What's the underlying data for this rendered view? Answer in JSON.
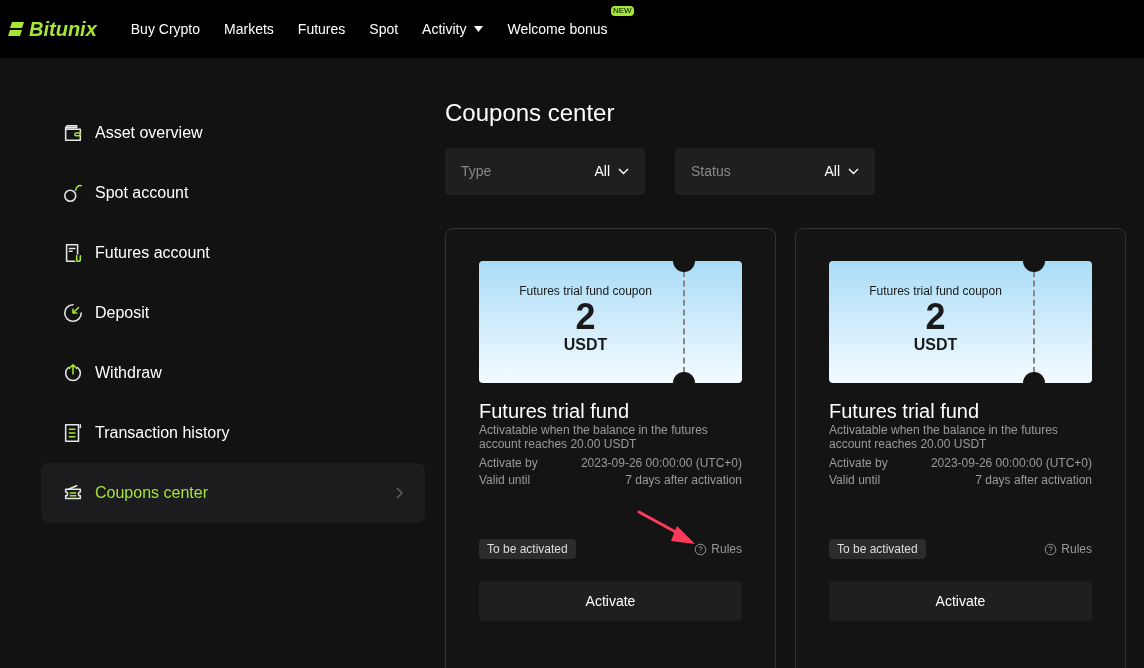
{
  "header": {
    "logo": "Bitunix",
    "nav": [
      {
        "label": "Buy Crypto",
        "dropdown": false
      },
      {
        "label": "Markets",
        "dropdown": false
      },
      {
        "label": "Futures",
        "dropdown": false
      },
      {
        "label": "Spot",
        "dropdown": false
      },
      {
        "label": "Activity",
        "dropdown": true
      },
      {
        "label": "Welcome bonus",
        "dropdown": false,
        "badge": "NEW"
      }
    ]
  },
  "sidebar": {
    "items": [
      {
        "kind": "wallet",
        "label": "Asset overview",
        "selected": false
      },
      {
        "kind": "spot",
        "label": "Spot account",
        "selected": false
      },
      {
        "kind": "futures",
        "label": "Futures account",
        "selected": false
      },
      {
        "kind": "deposit",
        "label": "Deposit",
        "selected": false
      },
      {
        "kind": "withdraw",
        "label": "Withdraw",
        "selected": false
      },
      {
        "kind": "history",
        "label": "Transaction history",
        "selected": false
      },
      {
        "kind": "coupon",
        "label": "Coupons center",
        "selected": true
      }
    ]
  },
  "main": {
    "title": "Coupons center",
    "filters": [
      {
        "label": "Type",
        "value": "All"
      },
      {
        "label": "Status",
        "value": "All"
      }
    ],
    "coupons": [
      {
        "ticket_title": "Futures trial fund coupon",
        "amount": "2",
        "unit": "USDT",
        "name": "Futures trial fund",
        "description": "Activatable when the balance in the futures account reaches 20.00 USDT",
        "details": [
          {
            "label": "Activate by",
            "value": "2023-09-26 00:00:00 (UTC+0)"
          },
          {
            "label": "Valid until",
            "value": "7 days after activation"
          }
        ],
        "status": "To be activated",
        "rules": "Rules",
        "button": "Activate",
        "annotation_arrow": true
      },
      {
        "ticket_title": "Futures trial fund coupon",
        "amount": "2",
        "unit": "USDT",
        "name": "Futures trial fund",
        "description": "Activatable when the balance in the futures account reaches 20.00 USDT",
        "details": [
          {
            "label": "Activate by",
            "value": "2023-09-26 00:00:00 (UTC+0)"
          },
          {
            "label": "Valid until",
            "value": "7 days after activation"
          }
        ],
        "status": "To be activated",
        "rules": "Rules",
        "button": "Activate",
        "annotation_arrow": false
      }
    ]
  }
}
